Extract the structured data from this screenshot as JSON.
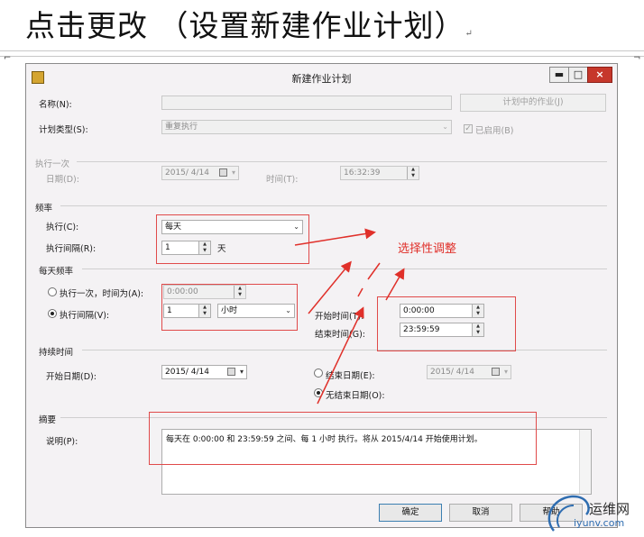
{
  "heading": "点击更改 （设置新建作业计划）",
  "heading_mark": "↵",
  "window": {
    "title": "新建作业计划",
    "minimize": "▬",
    "maximize": "□",
    "close": "×"
  },
  "name": {
    "label": "名称(N):",
    "value": "",
    "button": "计划中的作业(J)"
  },
  "schedule_type": {
    "label": "计划类型(S):",
    "value": "重复执行",
    "enabled_label": "已启用(B)"
  },
  "once": {
    "group": "执行一次",
    "date_label": "日期(D):",
    "date_value": "2015/ 4/14",
    "time_label": "时间(T):",
    "time_value": "16:32:39"
  },
  "frequency": {
    "group": "频率",
    "occurs_label": "执行(C):",
    "occurs_value": "每天",
    "recurs_label": "执行间隔(R):",
    "recurs_value": "1",
    "recurs_unit": "天"
  },
  "daily": {
    "group": "每天频率",
    "once_label": "执行一次，时间为(A):",
    "once_value": "0:00:00",
    "every_label": "执行间隔(V):",
    "every_value": "1",
    "every_unit": "小时",
    "start_label": "开始时间(T):",
    "start_value": "0:00:00",
    "end_label": "结束时间(G):",
    "end_value": "23:59:59"
  },
  "duration": {
    "group": "持续时间",
    "start_label": "开始日期(D):",
    "start_value": "2015/ 4/14",
    "end_label": "结束日期(E):",
    "end_value": "2015/ 4/14",
    "no_end_label": "无结束日期(O):"
  },
  "summary": {
    "group": "摘要",
    "desc_label": "说明(P):",
    "desc_value": "每天在 0:00:00 和 23:59:59 之间、每 1 小时 执行。将从 2015/4/14 开始使用计划。"
  },
  "buttons": {
    "ok": "确定",
    "cancel": "取消",
    "help": "帮助"
  },
  "annotation": {
    "text": "选择性调整",
    "color": "#e0302a"
  },
  "watermark": {
    "cn": "运维网",
    "en": "iyunv.com"
  }
}
